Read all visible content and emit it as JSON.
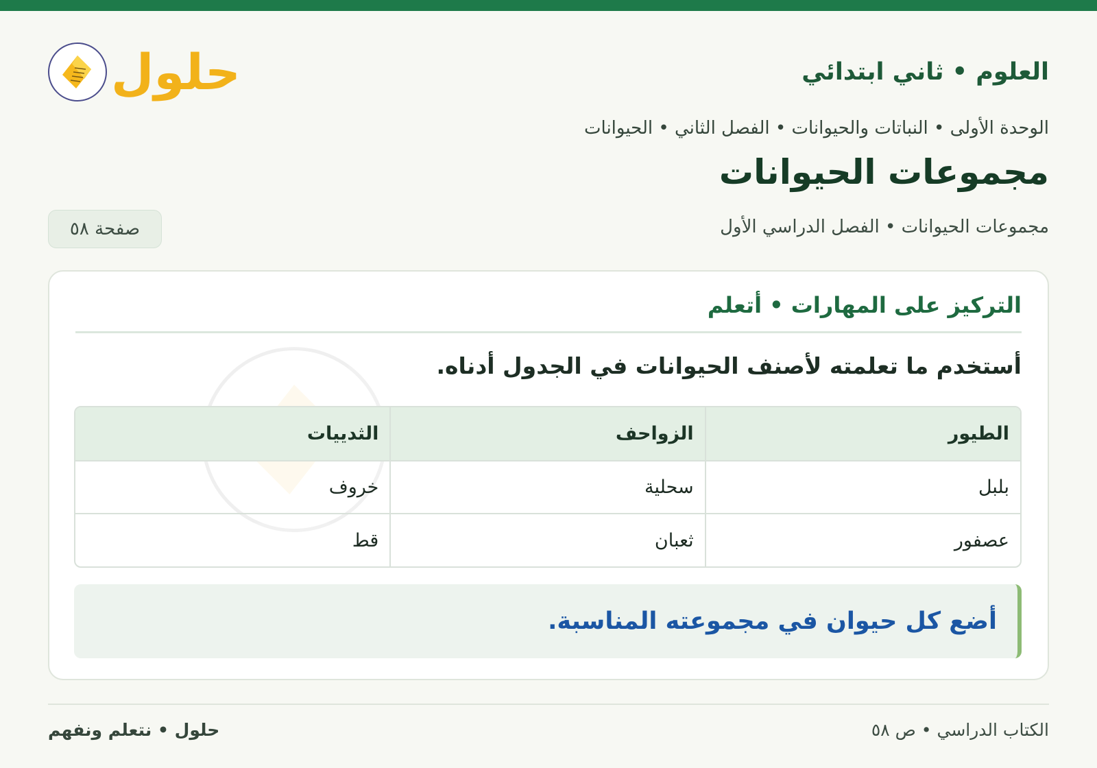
{
  "header": {
    "subject": "العلوم • ثاني ابتدائي",
    "logo_text": "حلول"
  },
  "breadcrumb": "الوحدة الأولى • النباتات والحيوانات • الفصل الثاني • الحيوانات",
  "page_title": "مجموعات الحيوانات",
  "subtitle": "مجموعات الحيوانات • الفصل الدراسي الأول",
  "page_badge": "صفحة ٥٨",
  "card": {
    "section_title": "التركيز على المهارات • أتعلم",
    "instruction": "أستخدم ما تعلمته لأصنف الحيوانات في الجدول أدناه.",
    "table": {
      "headers": [
        "الطيور",
        "الزواحف",
        "الثدييات"
      ],
      "rows": [
        [
          "بلبل",
          "سحلية",
          "خروف"
        ],
        [
          "عصفور",
          "ثعبان",
          "قط"
        ]
      ]
    },
    "callout": "أضع كل حيوان في مجموعته المناسبة."
  },
  "footer": {
    "left": "حلول • نتعلم ونفهم",
    "right": "الكتاب الدراسي • ص ٥٨"
  },
  "colors": {
    "accent_green": "#1e7a4a",
    "logo_yellow": "#f2b21a",
    "callout_blue": "#1b56a4"
  }
}
